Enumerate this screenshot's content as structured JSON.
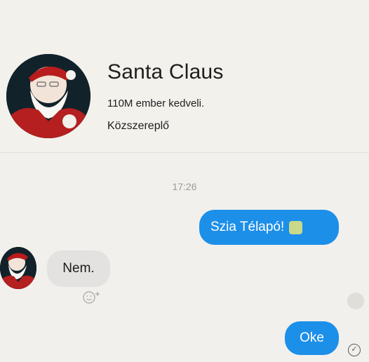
{
  "profile": {
    "name": "Santa Claus",
    "likes": "110M ember kedveli.",
    "category": "Közszereplő"
  },
  "chat": {
    "timestamp": "17:26",
    "messages": [
      {
        "direction": "outgoing",
        "text": "Szia Télapó!",
        "emoji": "gift-emoji"
      },
      {
        "direction": "incoming",
        "text": "Nem."
      },
      {
        "direction": "outgoing",
        "text": "Oke"
      }
    ]
  },
  "colors": {
    "outgoing_bubble": "#1c8fe9",
    "incoming_bubble": "#e4e2e0",
    "background": "#f2f0ec"
  },
  "icons": {
    "react": "add-reaction-icon",
    "seen": "seen-avatar-icon",
    "delivered": "delivered-check-icon"
  }
}
